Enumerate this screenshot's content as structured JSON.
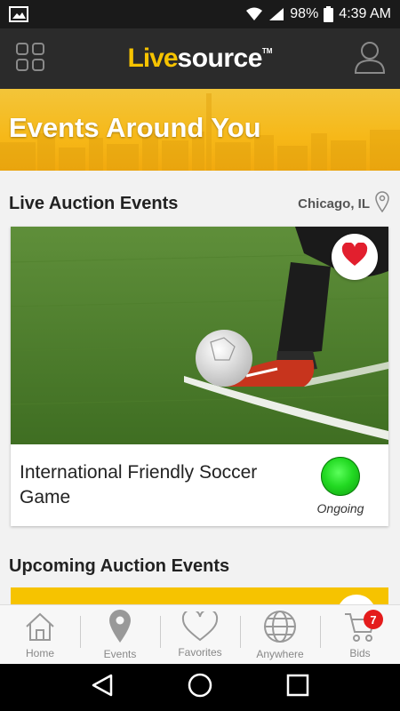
{
  "status_bar": {
    "battery": "98%",
    "time": "4:39 AM"
  },
  "app_bar": {
    "logo_live": "Live",
    "logo_source": "source",
    "logo_tm": "TM"
  },
  "hero": {
    "title": "Events Around You"
  },
  "live_section": {
    "title": "Live Auction Events",
    "location": "Chicago, IL"
  },
  "live_event": {
    "title": "International Friendly Soccer Game",
    "status": "Ongoing",
    "status_color": "#22d922",
    "favorited": true
  },
  "upcoming_section": {
    "title": "Upcoming Auction Events"
  },
  "bottom_nav": {
    "items": [
      {
        "label": "Home",
        "icon": "home-icon"
      },
      {
        "label": "Events",
        "icon": "location-pin-icon"
      },
      {
        "label": "Favorites",
        "icon": "heart-icon"
      },
      {
        "label": "Anywhere",
        "icon": "globe-icon"
      },
      {
        "label": "Bids",
        "icon": "cart-icon",
        "badge": "7"
      }
    ]
  },
  "colors": {
    "brand_yellow": "#f6c300",
    "app_bar": "#2b2b2b",
    "heart_red": "#e21f2e",
    "badge_red": "#e41c1c"
  }
}
